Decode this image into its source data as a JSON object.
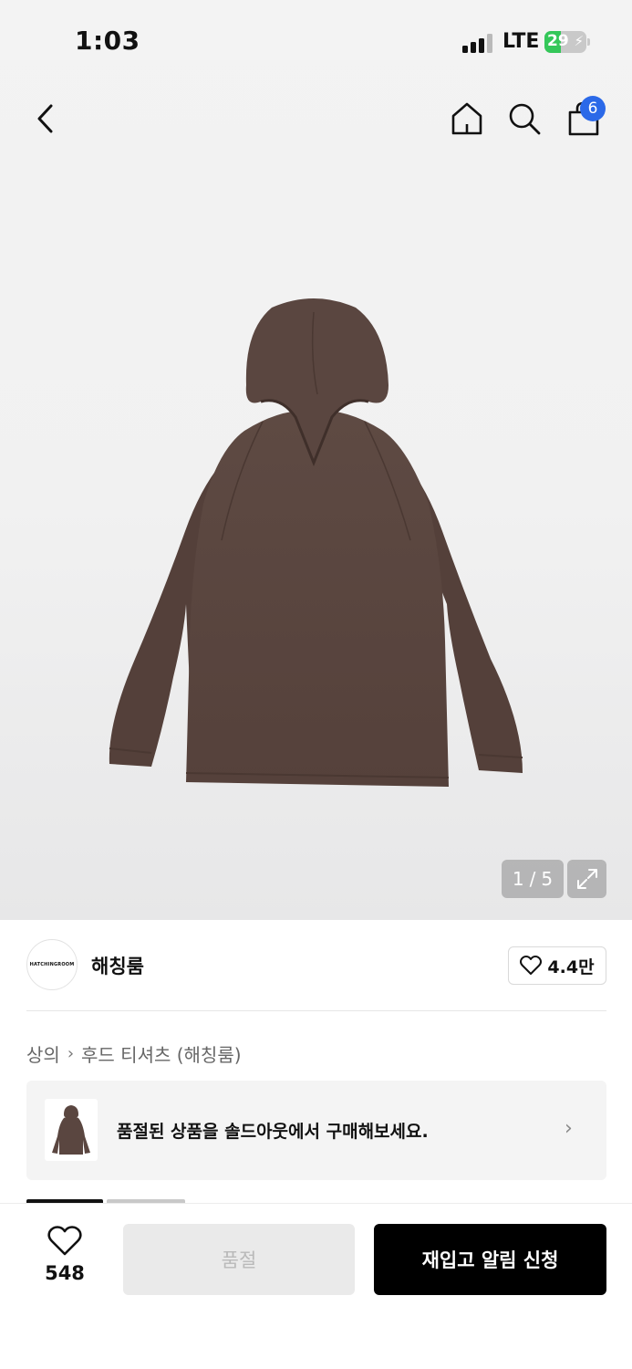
{
  "status_bar": {
    "time": "1:03",
    "network": "LTE",
    "battery_level": "29"
  },
  "header": {
    "cart_count": "6"
  },
  "gallery": {
    "current": "1",
    "separator": "/",
    "total": "5"
  },
  "brand": {
    "name": "해칭룸",
    "logo_text": "HATCHINGROOM",
    "likes": "4.4만"
  },
  "breadcrumb": {
    "items": [
      "상의",
      "후드 티셔츠 (해칭룸)"
    ]
  },
  "soldout_banner": {
    "text": "품절된 상품을 솔드아웃에서 구매해보세요."
  },
  "bottom_bar": {
    "wish_count": "548",
    "soldout_label": "품절",
    "restock_label": "재입고 알림 신청"
  },
  "colors": {
    "accent_badge": "#2b69e8",
    "product": "#5b4740",
    "primary_button": "#000000"
  }
}
